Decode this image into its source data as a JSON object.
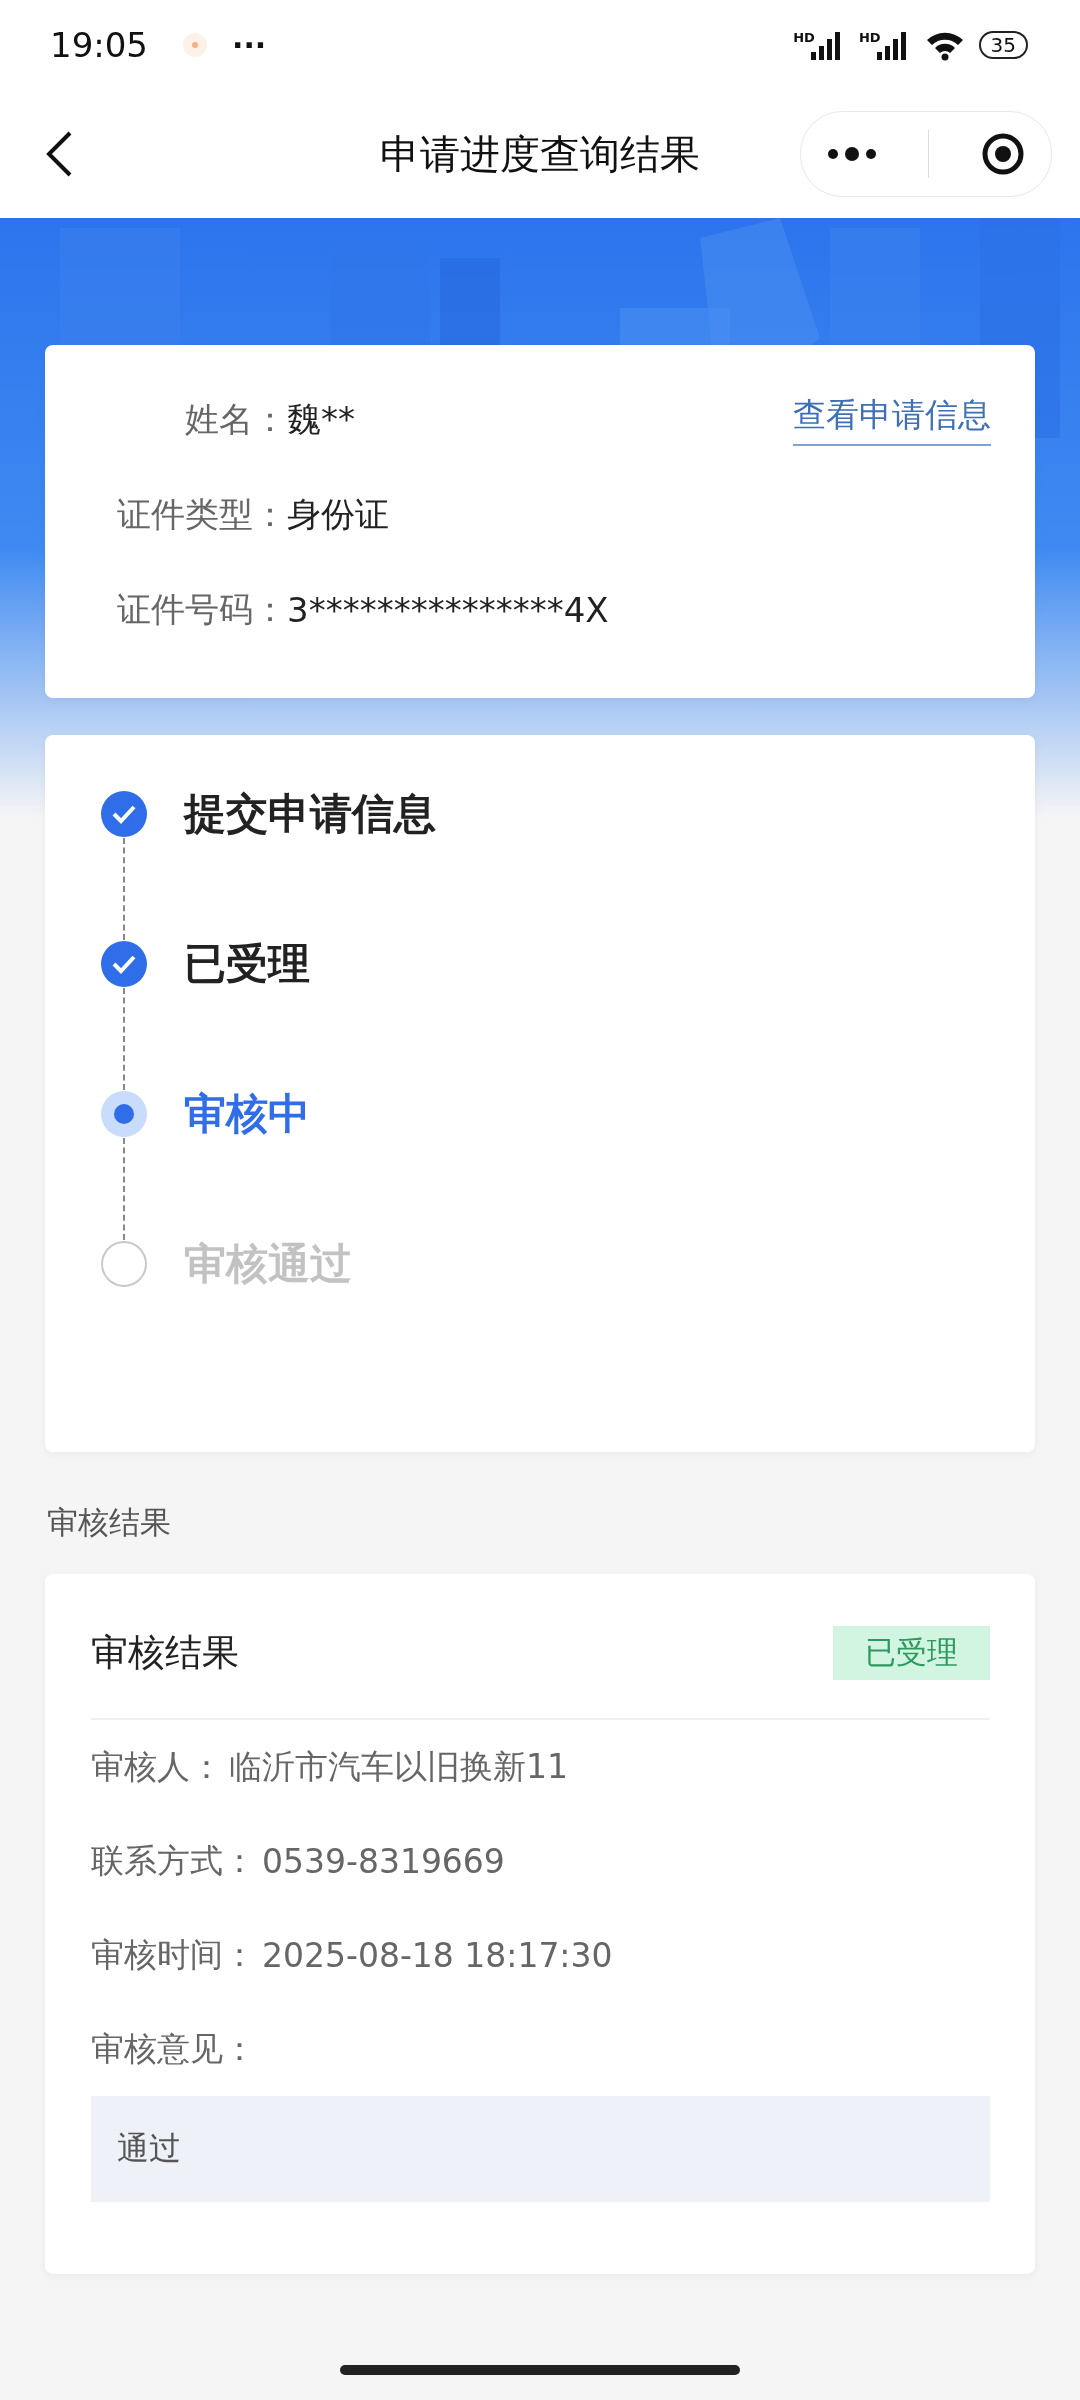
{
  "status_bar": {
    "time": "19:05",
    "dots": "···",
    "signals": [
      {
        "label": "HD"
      },
      {
        "label": "HD"
      }
    ],
    "battery": "35"
  },
  "nav": {
    "title": "申请进度查询结果"
  },
  "applicant": {
    "link": "查看申请信息",
    "fields": [
      {
        "label": "姓名：",
        "value": "魏**"
      },
      {
        "label": "证件类型：",
        "value": "身份证"
      },
      {
        "label": "证件号码：",
        "value": "3***************4X"
      }
    ]
  },
  "steps": [
    {
      "label": "提交申请信息",
      "kind": "done"
    },
    {
      "label": "已受理",
      "kind": "done"
    },
    {
      "label": "审核中",
      "kind": "current"
    },
    {
      "label": "审核通过",
      "kind": "pending"
    }
  ],
  "section_title": "审核结果",
  "result": {
    "title": "审核结果",
    "badge": "已受理",
    "fields": [
      {
        "label": "审核人：",
        "value": "临沂市汽车以旧换新11"
      },
      {
        "label": "联系方式：",
        "value": "0539-8319669"
      },
      {
        "label": "审核时间：",
        "value": "2025-08-18 18:17:30"
      },
      {
        "label": "审核意见："
      }
    ],
    "opinion": "通过"
  }
}
